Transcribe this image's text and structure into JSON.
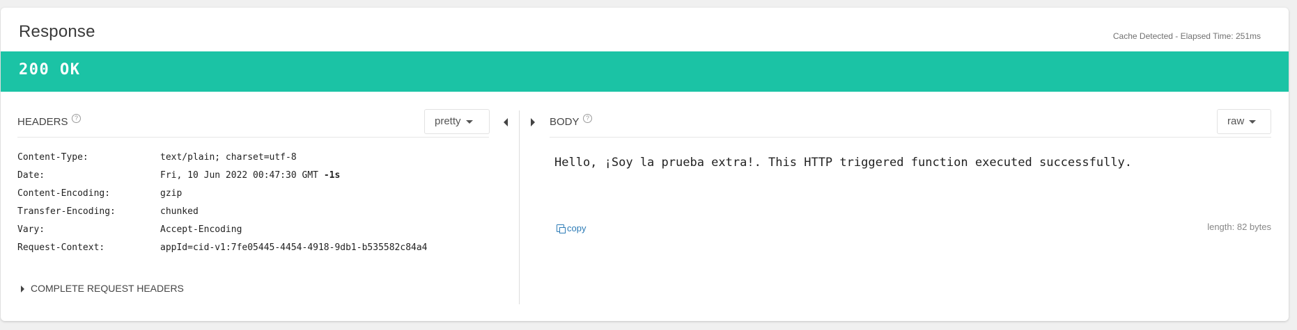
{
  "response": {
    "title": "Response",
    "meta": "Cache Detected - Elapsed Time: 251ms",
    "status": "200 OK",
    "status_color": "#1bc3a5"
  },
  "headers_section": {
    "label": "HEADERS",
    "help_icon": "question-circle-icon",
    "format": "pretty",
    "rows": [
      {
        "key": "Content-Type:",
        "value": "text/plain; charset=utf-8",
        "suffix": ""
      },
      {
        "key": "Date:",
        "value": "Fri, 10 Jun 2022 00:47:30 GMT ",
        "suffix": "-1s"
      },
      {
        "key": "Content-Encoding:",
        "value": "gzip",
        "suffix": ""
      },
      {
        "key": "Transfer-Encoding:",
        "value": "chunked",
        "suffix": ""
      },
      {
        "key": "Vary:",
        "value": "Accept-Encoding",
        "suffix": ""
      },
      {
        "key": "Request-Context:",
        "value": "appId=cid-v1:7fe05445-4454-4918-9db1-b535582c84a4",
        "suffix": ""
      }
    ],
    "complete_request_label": "COMPLETE REQUEST HEADERS"
  },
  "body_section": {
    "label": "BODY",
    "help_icon": "question-circle-icon",
    "format": "raw",
    "content": "Hello, ¡Soy la prueba extra!. This HTTP triggered function executed successfully.",
    "copy_label": "copy",
    "length": "length: 82 bytes"
  }
}
